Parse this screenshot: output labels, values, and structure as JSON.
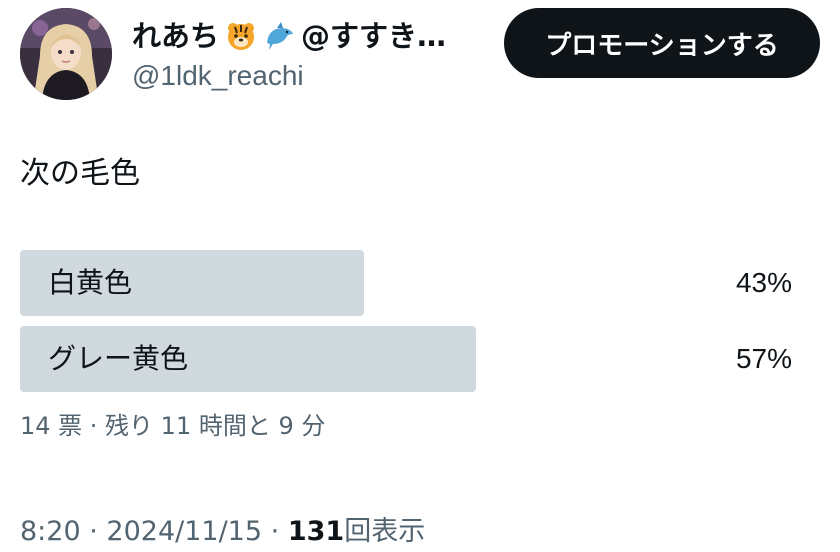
{
  "author": {
    "display_name": "れあち",
    "name_suffix": "@すすき…",
    "emojis": [
      "tiger-face-icon",
      "dolphin-icon"
    ],
    "handle": "@1ldk_reachi"
  },
  "promote_button": {
    "label": "プロモーションする"
  },
  "tweet": {
    "text": "次の毛色"
  },
  "poll": {
    "options": [
      {
        "label": "白黄色",
        "percent_text": "43%",
        "percent": 43
      },
      {
        "label": "グレー黄色",
        "percent_text": "57%",
        "percent": 57
      }
    ],
    "meta": "14 票 · 残り 11 時間と 9 分"
  },
  "footer": {
    "time": "8:20",
    "separator": "·",
    "date": "2024/11/15",
    "views_count": "131",
    "views_label": "回表示"
  },
  "colors": {
    "poll_bar": "#cfd9de",
    "secondary_text": "#536471",
    "primary_text": "#0f1419",
    "button_bg": "#0f1419"
  }
}
